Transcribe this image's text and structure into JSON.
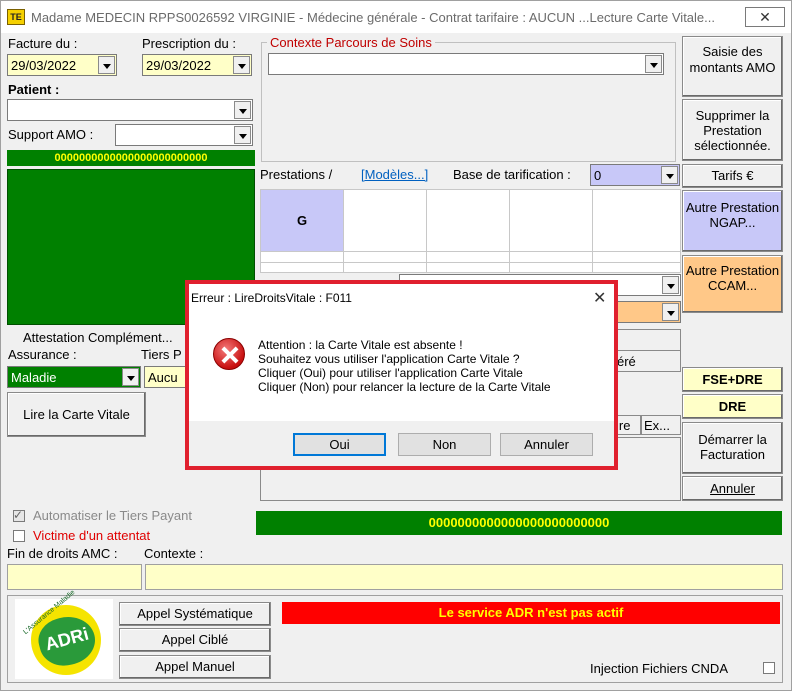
{
  "window": {
    "title": "Madame MEDECIN RPPS0026592 VIRGINIE - Médecine générale - Contrat tarifaire : AUCUN    ...Lecture Carte Vitale...",
    "close_symbol": "☒"
  },
  "left": {
    "facture_label": "Facture du :",
    "facture_date": "29/03/2022",
    "prescription_label": "Prescription du :",
    "prescription_date": "29/03/2022",
    "patient_label": "Patient :",
    "support_amo_label": "Support AMO :",
    "zeros_short": "0000000000000000000000000",
    "attestation_label": "Attestation Complément...",
    "assurance_label": "Assurance :",
    "tiers_label": "Tiers P",
    "assurance_value": "Maladie",
    "tiers_value": "Aucu",
    "lire_carte_label": "Lire la Carte Vitale",
    "automatiser_label": "Automatiser le Tiers Payant",
    "victime_label": "Victime d'un attentat",
    "fin_droits_label": "Fin de droits AMC :",
    "contexte_label": "Contexte :"
  },
  "middle": {
    "parcours_label": "Contexte Parcours de Soins",
    "prestations_label": "Prestations /",
    "modeles_link": "[Modèles...]",
    "base_tarif_label": "Base de tarification :",
    "base_tarif_value": "0",
    "grid_header_g": "G",
    "partial_ere": "éré",
    "partial_ire": "ire",
    "partial_ex": "Ex...",
    "zeros_long": "0000000000000000000000000"
  },
  "right_buttons": {
    "saisie_amo": "Saisie des montants AMO",
    "supprimer": "Supprimer la Prestation sélectionnée.",
    "tarifs": "Tarifs €",
    "ngap": "Autre Prestation NGAP...",
    "ccam": "Autre Prestation CCAM...",
    "fse_dre": "FSE+DRE",
    "dre": "DRE",
    "demarrer": "Démarrer la Facturation",
    "annuler": "Annuler"
  },
  "bottom": {
    "logo_text_arc": "L'Assurance Maladie",
    "logo_text": "ADRi",
    "appel_systematique": "Appel Systématique",
    "appel_cible": "Appel Ciblé",
    "appel_manuel": "Appel Manuel",
    "adr_status": "Le service ADR n'est pas actif",
    "injection_label": "Injection Fichiers CNDA"
  },
  "dialog": {
    "title": "Erreur : LireDroitsVitale : F011",
    "line1": "Attention : la Carte Vitale est absente !",
    "line2": "Souhaitez vous utiliser l'application  Carte Vitale ?",
    "line3": "Cliquer (Oui) pour utiliser l'application Carte Vitale",
    "line4": "Cliquer (Non) pour relancer la lecture de la Carte Vitale",
    "oui": "Oui",
    "non": "Non",
    "annuler": "Annuler",
    "close": "✕"
  },
  "colors": {
    "green": "#008000",
    "yellow_text": "#ffff00",
    "lavender": "#c8c8f8",
    "peach": "#ffc888",
    "yellow_field": "#ffffc8",
    "adr_red": "#ff0000",
    "dialog_border": "#e0202e"
  }
}
